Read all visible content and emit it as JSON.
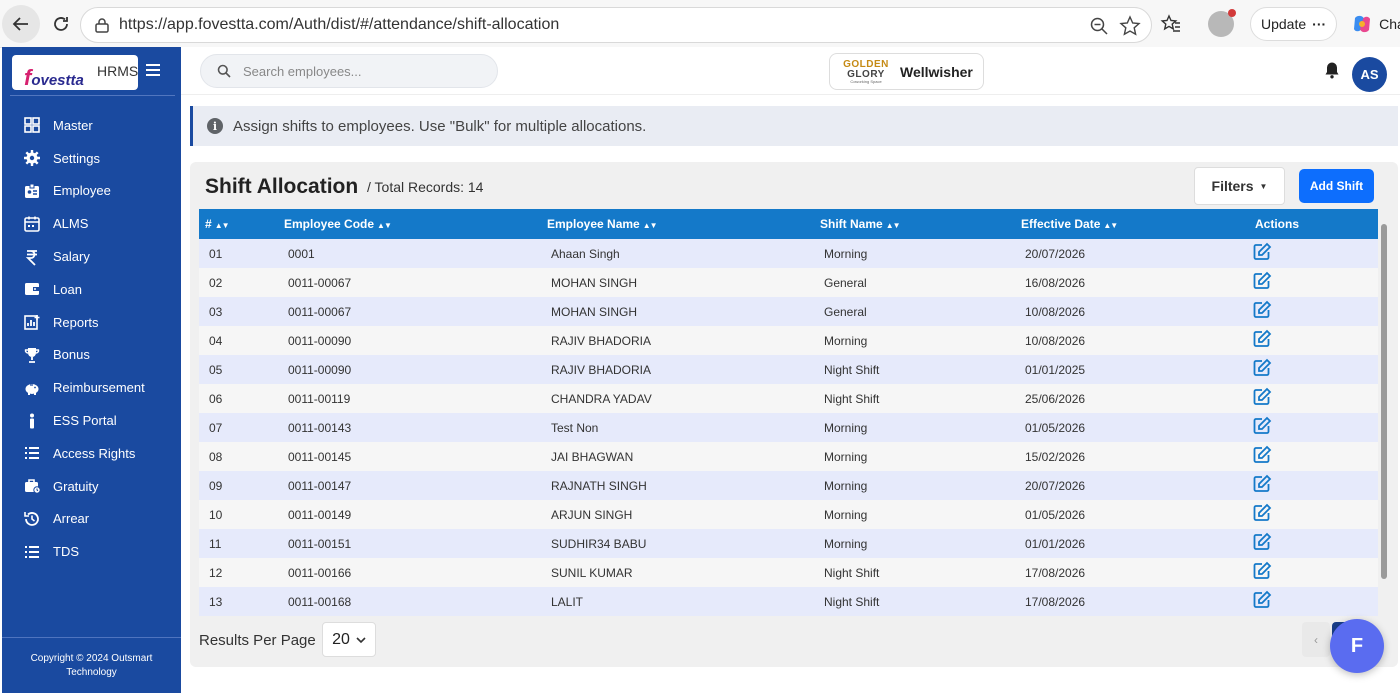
{
  "browser": {
    "url": "https://app.fovestta.com/Auth/dist/#/attendance/shift-allocation",
    "update_label": "Update",
    "chat_label": "Chat"
  },
  "sidebar": {
    "logo_text": "fovestta",
    "product": "HRMS",
    "items": [
      {
        "label": "Master",
        "icon": "grid-icon"
      },
      {
        "label": "Settings",
        "icon": "gear-icon"
      },
      {
        "label": "Employee",
        "icon": "id-card-icon"
      },
      {
        "label": "ALMS",
        "icon": "calendar-icon"
      },
      {
        "label": "Salary",
        "icon": "rupee-icon"
      },
      {
        "label": "Loan",
        "icon": "wallet-icon"
      },
      {
        "label": "Reports",
        "icon": "chart-icon"
      },
      {
        "label": "Bonus",
        "icon": "trophy-icon"
      },
      {
        "label": "Reimbursement",
        "icon": "piggy-bank-icon"
      },
      {
        "label": "ESS Portal",
        "icon": "person-icon"
      },
      {
        "label": "Access Rights",
        "icon": "list-icon"
      },
      {
        "label": "Gratuity",
        "icon": "briefcase-icon"
      },
      {
        "label": "Arrear",
        "icon": "history-icon"
      },
      {
        "label": "TDS",
        "icon": "list-icon"
      }
    ],
    "footer_line1": "Copyright © 2024 Outsmart",
    "footer_line2": "Technology"
  },
  "topbar": {
    "search_placeholder": "Search employees...",
    "company_logo_line1": "GOLDEN",
    "company_logo_line2": "GLORY",
    "company_logo_line3": "Coworking Space",
    "company_name": "Wellwisher",
    "avatar_initials": "AS"
  },
  "banner": {
    "text": "Assign shifts to employees. Use \"Bulk\" for multiple allocations."
  },
  "card": {
    "title": "Shift Allocation",
    "subtitle": "/ Total Records: 14",
    "filters_label": "Filters",
    "add_label": "Add Shift",
    "results_per_page_label": "Results Per Page",
    "results_per_page_value": "20"
  },
  "table": {
    "headers": [
      "#",
      "Employee Code",
      "Employee Name",
      "Shift Name",
      "Effective Date",
      "Actions"
    ],
    "rows": [
      {
        "num": "01",
        "code": "0001",
        "name": "Ahaan Singh",
        "shift": "Morning",
        "date": "20/07/2026"
      },
      {
        "num": "02",
        "code": "0011-00067",
        "name": "MOHAN SINGH",
        "shift": "General",
        "date": "16/08/2026"
      },
      {
        "num": "03",
        "code": "0011-00067",
        "name": "MOHAN SINGH",
        "shift": "General",
        "date": "10/08/2026"
      },
      {
        "num": "04",
        "code": "0011-00090",
        "name": "RAJIV BHADORIA",
        "shift": "Morning",
        "date": "10/08/2026"
      },
      {
        "num": "05",
        "code": "0011-00090",
        "name": "RAJIV BHADORIA",
        "shift": "Night Shift",
        "date": "01/01/2025"
      },
      {
        "num": "06",
        "code": "0011-00119",
        "name": "CHANDRA YADAV",
        "shift": "Night Shift",
        "date": "25/06/2026"
      },
      {
        "num": "07",
        "code": "0011-00143",
        "name": "Test Non",
        "shift": "Morning",
        "date": "01/05/2026"
      },
      {
        "num": "08",
        "code": "0011-00145",
        "name": "JAI BHAGWAN",
        "shift": "Morning",
        "date": "15/02/2026"
      },
      {
        "num": "09",
        "code": "0011-00147",
        "name": "RAJNATH SINGH",
        "shift": "Morning",
        "date": "20/07/2026"
      },
      {
        "num": "10",
        "code": "0011-00149",
        "name": "ARJUN SINGH",
        "shift": "Morning",
        "date": "01/05/2026"
      },
      {
        "num": "11",
        "code": "0011-00151",
        "name": "SUDHIR34 BABU",
        "shift": "Morning",
        "date": "01/01/2026"
      },
      {
        "num": "12",
        "code": "0011-00166",
        "name": "SUNIL KUMAR",
        "shift": "Night Shift",
        "date": "17/08/2026"
      },
      {
        "num": "13",
        "code": "0011-00168",
        "name": "LALIT",
        "shift": "Night Shift",
        "date": "17/08/2026"
      }
    ]
  },
  "fab_label": "F",
  "colors": {
    "sidebar": "#1a4aa0",
    "table_header": "#1479c9",
    "primary_button": "#0d6efd",
    "row_alt": "#e6eafb"
  }
}
